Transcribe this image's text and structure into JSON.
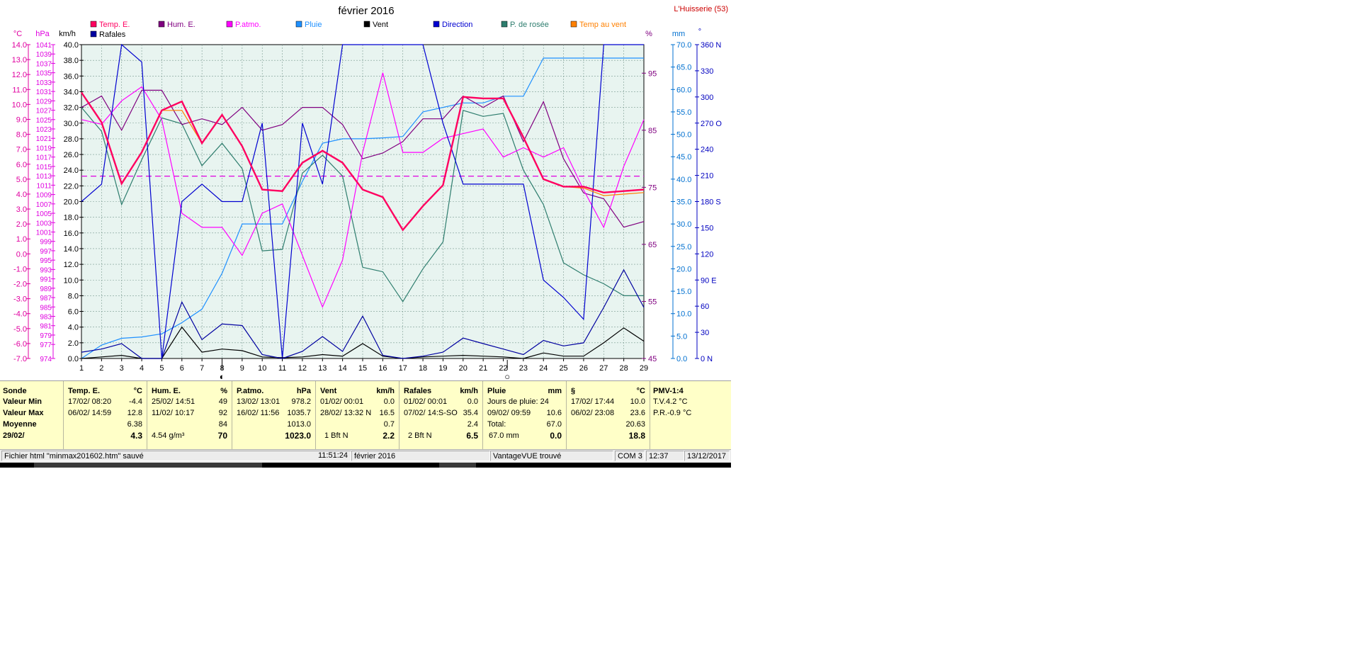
{
  "app": {
    "location": "L'Huisserie (53)"
  },
  "chart_data": {
    "type": "line",
    "title": "février 2016",
    "x": [
      1,
      2,
      3,
      4,
      5,
      6,
      7,
      8,
      9,
      10,
      11,
      12,
      13,
      14,
      15,
      16,
      17,
      18,
      19,
      20,
      21,
      22,
      23,
      24,
      25,
      26,
      27,
      28,
      29
    ],
    "xlim": [
      1,
      29
    ],
    "grid": true,
    "legend_placement": "top",
    "axes": [
      {
        "id": "temp",
        "unit": "°C",
        "range": [
          -7,
          14
        ],
        "ticks": [
          -7,
          -6,
          -5,
          -4,
          -3,
          -2,
          -1,
          0,
          1,
          2,
          3,
          4,
          5,
          6,
          7,
          8,
          9,
          10,
          11,
          12,
          13,
          14
        ],
        "color": "#e000a0",
        "position": "left",
        "decimals": 1
      },
      {
        "id": "press",
        "unit": "hPa",
        "range": [
          974,
          1041
        ],
        "ticks": [
          974,
          977,
          979,
          981,
          983,
          985,
          987,
          989,
          991,
          993,
          995,
          997,
          999,
          1001,
          1003,
          1005,
          1007,
          1009,
          1011,
          1013,
          1015,
          1017,
          1019,
          1021,
          1023,
          1025,
          1027,
          1029,
          1031,
          1033,
          1035,
          1037,
          1039,
          1041
        ],
        "color": "#e000e0",
        "position": "left"
      },
      {
        "id": "wind",
        "unit": "km/h",
        "range": [
          0,
          40
        ],
        "ticks": [
          0,
          2,
          4,
          6,
          8,
          10,
          12,
          14,
          16,
          18,
          20,
          22,
          24,
          26,
          28,
          30,
          32,
          34,
          36,
          38,
          40
        ],
        "color": "#000000",
        "position": "left",
        "decimals": 1
      },
      {
        "id": "hum",
        "unit": "%",
        "range": [
          45,
          100
        ],
        "ticks": [
          45,
          55,
          65,
          75,
          85,
          95
        ],
        "color": "#800080",
        "position": "right"
      },
      {
        "id": "rain",
        "unit": "mm",
        "range": [
          0,
          70
        ],
        "ticks": [
          0,
          5,
          10,
          15,
          20,
          25,
          30,
          35,
          40,
          45,
          50,
          55,
          60,
          65,
          70
        ],
        "color": "#0070d0",
        "position": "right",
        "decimals": 1
      },
      {
        "id": "dir",
        "unit": "°",
        "range": [
          0,
          360
        ],
        "ticks": [
          0,
          30,
          60,
          90,
          120,
          150,
          180,
          210,
          240,
          270,
          300,
          330,
          360
        ],
        "tick_labels": [
          "0  N",
          "30",
          "60",
          "90  E",
          "120",
          "150",
          "180 S",
          "210",
          "240",
          "270 O",
          "300",
          "330",
          "360 N"
        ],
        "color": "#0000c0",
        "position": "right"
      }
    ],
    "reference_line": {
      "axis": "temp",
      "value": 5.2,
      "color": "#e000e0",
      "style": "dashed"
    },
    "series": [
      {
        "name": "Temp. E.",
        "axis": "temp",
        "color": "#ff0060",
        "bold": true,
        "values": [
          10.8,
          8.8,
          4.7,
          6.8,
          9.6,
          10.2,
          7.4,
          9.3,
          7.2,
          4.3,
          4.2,
          6.1,
          6.9,
          6.1,
          4.3,
          3.8,
          1.6,
          3.2,
          4.6,
          10.5,
          10.4,
          10.4,
          7.8,
          5.0,
          4.5,
          4.5,
          4.1,
          4.2,
          4.3
        ]
      },
      {
        "name": "Hum. E.",
        "axis": "hum",
        "color": "#800080",
        "values": [
          89,
          91,
          85,
          92,
          92,
          86,
          87,
          86,
          89,
          85,
          86,
          89,
          89,
          86,
          80,
          81,
          83,
          87,
          87,
          91,
          89,
          91,
          83,
          90,
          80,
          74,
          73,
          68,
          69
        ]
      },
      {
        "name": "P.atmo.",
        "axis": "press",
        "color": "#ff00ff",
        "values": [
          1025,
          1024,
          1029,
          1032,
          1025,
          1005,
          1002,
          1002,
          996,
          1005,
          1007,
          996,
          985,
          995,
          1018,
          1035,
          1018,
          1018,
          1021,
          1022,
          1023,
          1017,
          1019,
          1017,
          1019,
          1010,
          1002,
          1015,
          1025
        ]
      },
      {
        "name": "Pluie",
        "axis": "rain",
        "color": "#1e90ff",
        "values": [
          0,
          3,
          4.5,
          4.8,
          5.5,
          8,
          11,
          19,
          30,
          30,
          30,
          39.5,
          48,
          49,
          49,
          49.2,
          49.5,
          55,
          56,
          57,
          57,
          58.5,
          58.5,
          67,
          67,
          67,
          67,
          67,
          67
        ]
      },
      {
        "name": "Vent",
        "axis": "wind",
        "color": "#000000",
        "values": [
          0,
          0.2,
          0.4,
          0,
          0,
          4,
          0.8,
          1.2,
          1,
          0.2,
          0.1,
          0.2,
          0.5,
          0.3,
          1.9,
          0.3,
          0,
          0.2,
          0.3,
          0.4,
          0.3,
          0.2,
          0,
          0.7,
          0.3,
          0.3,
          2,
          3.9,
          2.2
        ]
      },
      {
        "name": "Direction",
        "axis": "dir",
        "color": "#0000d0",
        "values": [
          180,
          200,
          360,
          340,
          0,
          180,
          200,
          180,
          180,
          270,
          0,
          270,
          200,
          360,
          360,
          360,
          360,
          360,
          270,
          200,
          200,
          200,
          200,
          90,
          70,
          45,
          360,
          360,
          360
        ]
      },
      {
        "name": "P. de rosée",
        "axis": "temp",
        "color": "#2e7d6e",
        "values": [
          9.8,
          8.2,
          3.3,
          6.3,
          9.1,
          8.7,
          5.9,
          7.4,
          5.7,
          0.2,
          0.3,
          5.4,
          6.6,
          5.2,
          -0.9,
          -1.2,
          -3.2,
          -1.0,
          0.8,
          9.6,
          9.2,
          9.4,
          5.6,
          3.3,
          -0.6,
          -1.4,
          -2.0,
          -2.8,
          -2.8
        ]
      },
      {
        "name": "Temp au vent",
        "axis": "temp",
        "color": "#ff8000",
        "values": [
          10.8,
          8.8,
          4.7,
          6.8,
          9.6,
          9.6,
          7.4,
          9.3,
          7.2,
          4.3,
          4.2,
          6.1,
          6.9,
          6.1,
          4.3,
          3.8,
          1.6,
          3.2,
          4.6,
          10.5,
          10.4,
          10.4,
          7.8,
          5.0,
          4.5,
          4.4,
          3.9,
          4.0,
          4.1
        ]
      },
      {
        "name": "Rafales",
        "axis": "wind",
        "color": "#0000a0",
        "values": [
          0.8,
          1.2,
          1.9,
          0,
          0,
          7.2,
          2.4,
          4.4,
          4.2,
          0.5,
          0,
          0.9,
          2.8,
          0.9,
          5.4,
          0.4,
          0,
          0.3,
          0.8,
          2.6,
          1.9,
          1.2,
          0.5,
          2.3,
          1.6,
          2.0,
          6.5,
          11.3,
          6.5
        ]
      }
    ],
    "moon_markers": [
      {
        "x": 8.0,
        "symbol": "◐",
        "label": "first-quarter"
      },
      {
        "x": 22.2,
        "symbol": "○",
        "label": "full-moon"
      }
    ]
  },
  "table": {
    "sonde": {
      "head": "Sonde",
      "min": "Valeur Min",
      "max": "Valeur Max",
      "moy": "Moyenne",
      "date": "29/02/"
    },
    "temp": {
      "head": "Temp. E.",
      "unit": "°C",
      "min_date": "17/02/  08:20",
      "min_val": "-4.4",
      "max_date": "06/02/  14:59",
      "max_val": "12.8",
      "moy_val": "6.38",
      "last_val": "4.3"
    },
    "hum": {
      "head": "Hum. E.",
      "unit": "%",
      "min_date": "25/02/  14:51",
      "min_val": "49",
      "max_date": "11/02/  10:17",
      "max_val": "92",
      "moy_val": "84",
      "last_extra": "4.54 g/m³",
      "last_val": "70"
    },
    "press": {
      "head": "P.atmo.",
      "unit": "hPa",
      "min_date": "13/02/  13:01",
      "min_val": "978.2",
      "max_date": "16/02/  11:56",
      "max_val": "1035.7",
      "moy_val": "1013.0",
      "last_val": "1023.0"
    },
    "vent": {
      "head": "Vent",
      "unit": "km/h",
      "min_date": "01/02/  00:01",
      "min_val": "0.0",
      "max_date": "28/02/  13:32  N",
      "max_val": "16.5",
      "moy_val": "0.7",
      "last_extra": "1 Bft N",
      "last_val": "2.2"
    },
    "raf": {
      "head": "Rafales",
      "unit": "km/h",
      "min_date": "01/02/  00:01",
      "min_val": "0.0",
      "max_date": "07/02/  14:S-SO",
      "max_val": "35.4",
      "moy_val": "2.4",
      "last_extra": "2 Bft N",
      "last_val": "6.5"
    },
    "pluie": {
      "head": "Pluie",
      "unit": "mm",
      "r1": "Jours de pluie: 24",
      "r2_date": "09/02/  09:59",
      "r2_val": "10.6",
      "r3_lbl": "Total:",
      "r3_val": "67.0",
      "r4_lbl": "67.0 mm",
      "r4_val": "0.0"
    },
    "s": {
      "head": "§",
      "unit": "°C",
      "min_date": "17/02/  17:44",
      "min_val": "10.0",
      "max_date": "06/02/  23:08",
      "max_val": "23.6",
      "moy_val": "20.63",
      "last_val": "18.8"
    },
    "pmv": {
      "head": "PMV-1:4",
      "r1": "T.V.4.2 °C",
      "r2": "P.R.-0.9 °C"
    }
  },
  "status": {
    "file": "Fichier html  \"minmax201602.htm\"  sauvé",
    "time": "11:51:24",
    "month": "février 2016",
    "station": "VantageVUE trouvé",
    "port": "COM 3",
    "clock": "12:37",
    "date": "13/12/2017"
  }
}
